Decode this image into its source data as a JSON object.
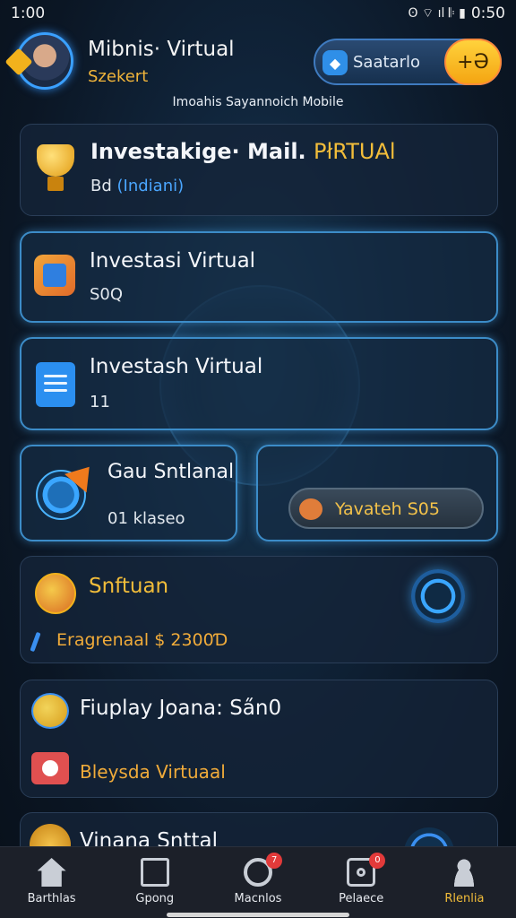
{
  "status_bar": {
    "left_time": "1:00",
    "right_icons_text": "ʘ ⌔ ıl 𝄆 ▮",
    "right_time": "0:50"
  },
  "header": {
    "user_name": "Mibnis· Virtual",
    "user_sub": "Szekert",
    "pill_label": "Saatarlo",
    "coin_label": "+Ə"
  },
  "subtitle": "Imoahis Sayannoich Mobile",
  "cards": [
    {
      "title": "Investakige· Mail.",
      "title_accent": "PłRTUAl",
      "value_prefix": "Bd",
      "value_blue": "(Indiani)"
    },
    {
      "title": "Investasi Virtual",
      "value": "S0Q"
    },
    {
      "title": "Investash Virtual",
      "value": "11"
    },
    {
      "title": "Gau Sntlanal",
      "value": "01 klaseo"
    },
    {
      "button_label": "Yavateh S05"
    },
    {
      "title": "Snftuan",
      "value": "Eragrenaal $ 2300Ɗ"
    },
    {
      "title": "Fiuplay Joana: Sa̋n0",
      "value": "Bleysda Virtuaal"
    },
    {
      "title": "Vinana Snttal"
    }
  ],
  "nav": [
    {
      "label": "Barthlas",
      "icon": "home-icon",
      "badge": ""
    },
    {
      "label": "Gpong",
      "icon": "document-icon",
      "badge": ""
    },
    {
      "label": "Macnlos",
      "icon": "circle-icon",
      "badge": "7"
    },
    {
      "label": "Pelaece",
      "icon": "camera-icon",
      "badge": "0"
    },
    {
      "label": "Rlenlia",
      "icon": "profile-icon",
      "badge": ""
    }
  ],
  "colors": {
    "accent_gold": "#f2bd3a",
    "accent_blue": "#3a8ff0",
    "background": "#0b1624"
  }
}
